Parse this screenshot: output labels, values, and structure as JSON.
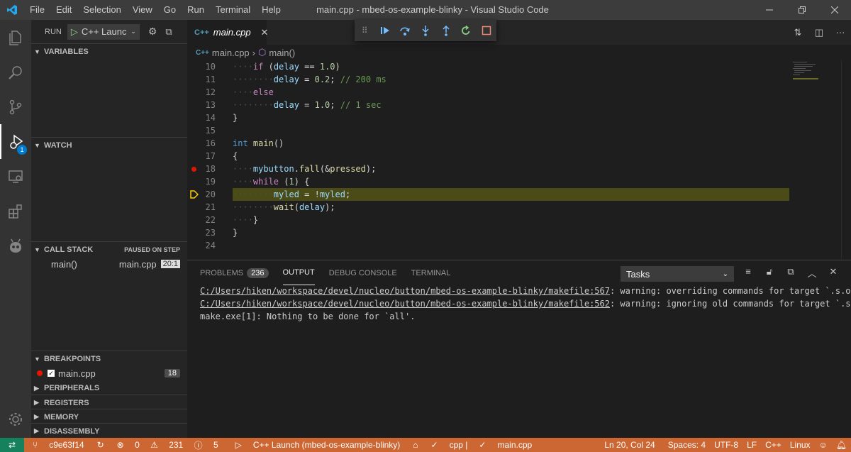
{
  "menu": [
    "File",
    "Edit",
    "Selection",
    "View",
    "Go",
    "Run",
    "Terminal",
    "Help"
  ],
  "window_title": "main.cpp - mbed-os-example-blinky - Visual Studio Code",
  "run": {
    "label": "RUN",
    "config": "C++ Launc"
  },
  "activity_badge": "1",
  "sections": {
    "variables": "VARIABLES",
    "watch": "WATCH",
    "call_stack": "CALL STACK",
    "call_stack_status": "PAUSED ON STEP",
    "breakpoints": "BREAKPOINTS",
    "peripherals": "PERIPHERALS",
    "registers": "REGISTERS",
    "memory": "MEMORY",
    "disassembly": "DISASSEMBLY"
  },
  "call_stack_frame": {
    "name": "main()",
    "file": "main.cpp",
    "pos": "20:1"
  },
  "breakpoint_item": {
    "file": "main.cpp",
    "line": "18"
  },
  "tab": {
    "icon": "C++",
    "name": "main.cpp"
  },
  "breadcrumb": {
    "file": "main.cpp",
    "symbol": "main()"
  },
  "code_lines": [
    {
      "n": "10",
      "html": "<span class='dots'>····</span><span class='kw'>if</span> (<span class='vr'>delay</span> == <span class='nu'>1.0</span>)"
    },
    {
      "n": "11",
      "html": "<span class='dots'>········</span><span class='vr'>delay</span> = <span class='nu'>0.2</span>; <span class='cm'>// 200 ms</span>"
    },
    {
      "n": "12",
      "html": "<span class='dots'>····</span><span class='kw'>else</span>"
    },
    {
      "n": "13",
      "html": "<span class='dots'>········</span><span class='vr'>delay</span> = <span class='nu'>1.0</span>; <span class='cm'>// 1 sec</span>"
    },
    {
      "n": "14",
      "html": "}"
    },
    {
      "n": "15",
      "html": ""
    },
    {
      "n": "16",
      "html": "<span class='ty'>int</span> <span class='fn'>main</span>()"
    },
    {
      "n": "17",
      "html": "{"
    },
    {
      "n": "18",
      "html": "<span class='dots'>····</span><span class='vr'>mybutton</span>.<span class='fn'>fall</span>(&amp;<span class='fn'>pressed</span>);"
    },
    {
      "n": "19",
      "html": "<span class='dots'>····</span><span class='kw'>while</span> (<span class='nu'>1</span>) {"
    },
    {
      "n": "20",
      "html": "<span class='dots'>········</span><span class='vr'>myled</span> = !<span class='vr'>myled</span>;"
    },
    {
      "n": "21",
      "html": "<span class='dots'>········</span><span class='fn'>wait</span>(<span class='vr'>delay</span>);"
    },
    {
      "n": "22",
      "html": "<span class='dots'>····</span>}"
    },
    {
      "n": "23",
      "html": "}"
    },
    {
      "n": "24",
      "html": ""
    }
  ],
  "panel": {
    "tabs": [
      "PROBLEMS",
      "OUTPUT",
      "DEBUG CONSOLE",
      "TERMINAL"
    ],
    "problems_count": "236",
    "task_select": "Tasks"
  },
  "output_lines": [
    {
      "link": "C:/Users/hiken/workspace/devel/nucleo/button/mbed-os-example-blinky/makefile:567",
      "rest": ": warning: overriding commands for target `.s.o"
    },
    {
      "link": "C:/Users/hiken/workspace/devel/nucleo/button/mbed-os-example-blinky/makefile:562",
      "rest": ": warning: ignoring old commands for target `.s"
    },
    {
      "link": "",
      "rest": "make.exe[1]: Nothing to be done for `all'."
    }
  ],
  "status": {
    "branch": "c9e63f14",
    "errors": "0",
    "warnings": "231",
    "info": "5",
    "debug": "C++ Launch (mbed-os-example-blinky)",
    "lang_file": "cpp | ",
    "file": "main.cpp",
    "position": "Ln 20, Col 24",
    "spaces": "Spaces: 4",
    "encoding": "UTF-8",
    "eol": "LF",
    "language": "C++",
    "os": "Linux"
  },
  "colors": {
    "status_bar": "#cc6633",
    "remote": "#16825d",
    "accent": "#007acc",
    "breakpoint": "#e51400"
  }
}
